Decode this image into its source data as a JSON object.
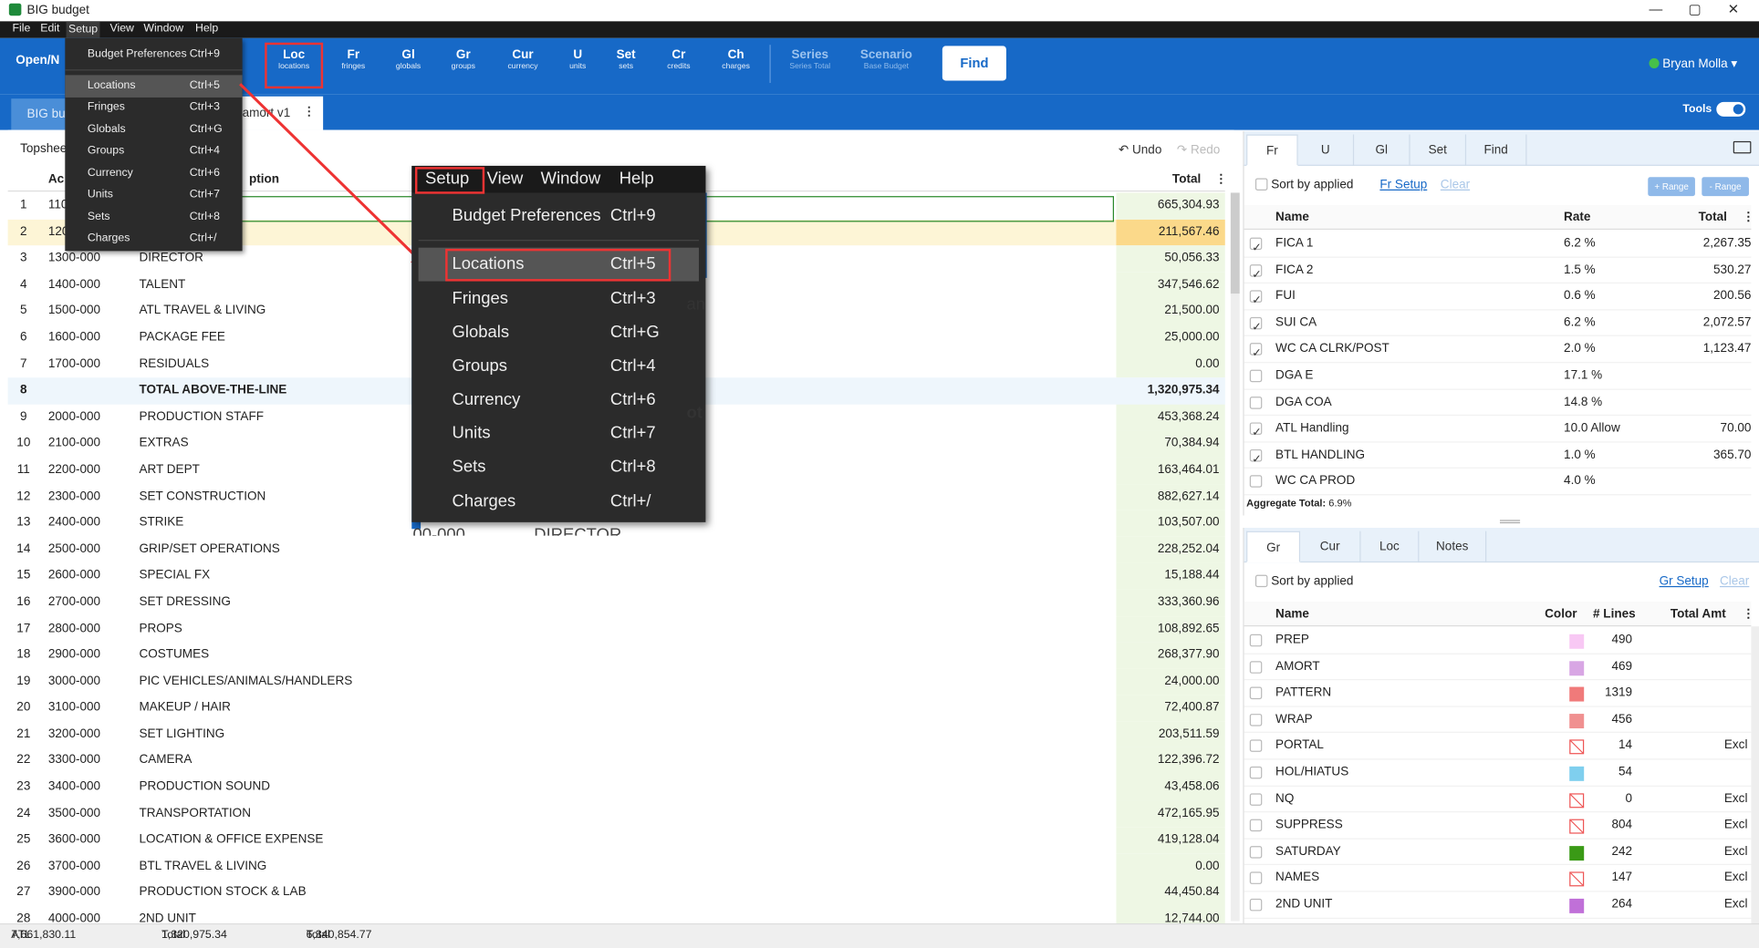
{
  "window": {
    "title": "BIG budget",
    "controls": [
      "—",
      "▢",
      "✕"
    ]
  },
  "menubar": [
    "File",
    "Edit",
    "Setup",
    "View",
    "Window",
    "Help"
  ],
  "toolbar": {
    "open_label": "Open/N",
    "buttons": [
      {
        "abbr": "Loc",
        "sub": "locations",
        "x": 239
      },
      {
        "abbr": "Fr",
        "sub": "fringes",
        "x": 292
      },
      {
        "abbr": "Gl",
        "sub": "globals",
        "x": 341
      },
      {
        "abbr": "Gr",
        "sub": "groups",
        "x": 390
      },
      {
        "abbr": "Cur",
        "sub": "currency",
        "x": 443
      },
      {
        "abbr": "U",
        "sub": "units",
        "x": 492
      },
      {
        "abbr": "Set",
        "sub": "sets",
        "x": 535
      },
      {
        "abbr": "Cr",
        "sub": "credits",
        "x": 582
      },
      {
        "abbr": "Ch",
        "sub": "charges",
        "x": 633
      }
    ],
    "series": {
      "abbr": "Series",
      "sub": "Series Total"
    },
    "scenario": {
      "abbr": "Scenario",
      "sub": "Base Budget"
    },
    "find_label": "Find",
    "user_name": "Bryan Molla ▾"
  },
  "tabs": {
    "tab1": "BIG bu",
    "tab2": "amort v1",
    "tools_label": "Tools"
  },
  "topsheet": {
    "label": "Topshee",
    "undo": "↶ Undo",
    "redo": "↷ Redo",
    "col_account": "Ac",
    "col_description": "ption",
    "col_total": "Total",
    "rows": [
      {
        "n": "1",
        "acct": "110",
        "desc": "",
        "total": "665,304.93"
      },
      {
        "n": "2",
        "acct": "120",
        "desc": "",
        "total": "211,567.46"
      },
      {
        "n": "3",
        "acct": "1300-000",
        "desc": "DIRECTOR",
        "total": "50,056.33"
      },
      {
        "n": "4",
        "acct": "1400-000",
        "desc": "TALENT",
        "total": "347,546.62"
      },
      {
        "n": "5",
        "acct": "1500-000",
        "desc": "ATL TRAVEL & LIVING",
        "total": "21,500.00"
      },
      {
        "n": "6",
        "acct": "1600-000",
        "desc": "PACKAGE FEE",
        "total": "25,000.00"
      },
      {
        "n": "7",
        "acct": "1700-000",
        "desc": "RESIDUALS",
        "total": "0.00"
      },
      {
        "n": "8",
        "acct": "",
        "desc": "TOTAL ABOVE-THE-LINE",
        "total": "1,320,975.34"
      },
      {
        "n": "9",
        "acct": "2000-000",
        "desc": "PRODUCTION STAFF",
        "total": "453,368.24"
      },
      {
        "n": "10",
        "acct": "2100-000",
        "desc": "EXTRAS",
        "total": "70,384.94"
      },
      {
        "n": "11",
        "acct": "2200-000",
        "desc": "ART DEPT",
        "total": "163,464.01"
      },
      {
        "n": "12",
        "acct": "2300-000",
        "desc": "SET CONSTRUCTION",
        "total": "882,627.14"
      },
      {
        "n": "13",
        "acct": "2400-000",
        "desc": "STRIKE",
        "total": "103,507.00"
      },
      {
        "n": "14",
        "acct": "2500-000",
        "desc": "GRIP/SET OPERATIONS",
        "total": "228,252.04"
      },
      {
        "n": "15",
        "acct": "2600-000",
        "desc": "SPECIAL FX",
        "total": "15,188.44"
      },
      {
        "n": "16",
        "acct": "2700-000",
        "desc": "SET DRESSING",
        "total": "333,360.96"
      },
      {
        "n": "17",
        "acct": "2800-000",
        "desc": "PROPS",
        "total": "108,892.65"
      },
      {
        "n": "18",
        "acct": "2900-000",
        "desc": "COSTUMES",
        "total": "268,377.90"
      },
      {
        "n": "19",
        "acct": "3000-000",
        "desc": "PIC VEHICLES/ANIMALS/HANDLERS",
        "total": "24,000.00"
      },
      {
        "n": "20",
        "acct": "3100-000",
        "desc": "MAKEUP / HAIR",
        "total": "72,400.87"
      },
      {
        "n": "21",
        "acct": "3200-000",
        "desc": "SET LIGHTING",
        "total": "203,511.59"
      },
      {
        "n": "22",
        "acct": "3300-000",
        "desc": "CAMERA",
        "total": "122,396.72"
      },
      {
        "n": "23",
        "acct": "3400-000",
        "desc": "PRODUCTION SOUND",
        "total": "43,458.06"
      },
      {
        "n": "24",
        "acct": "3500-000",
        "desc": "TRANSPORTATION",
        "total": "472,165.95"
      },
      {
        "n": "25",
        "acct": "3600-000",
        "desc": "LOCATION & OFFICE EXPENSE",
        "total": "419,128.04"
      },
      {
        "n": "26",
        "acct": "3700-000",
        "desc": "BTL TRAVEL & LIVING",
        "total": "0.00"
      },
      {
        "n": "27",
        "acct": "3900-000",
        "desc": "PRODUCTION STOCK & LAB",
        "total": "44,450.84"
      },
      {
        "n": "28",
        "acct": "4000-000",
        "desc": "2ND UNIT",
        "total": "12,744.00"
      }
    ]
  },
  "fringes_panel": {
    "tabs": [
      "Fr",
      "U",
      "Gl",
      "Set",
      "Find"
    ],
    "sort_label": "Sort by applied",
    "setup_link": "Fr Setup",
    "clear_link": "Clear",
    "add_range": "+ Range",
    "remove_range": "- Range",
    "col_name": "Name",
    "col_rate": "Rate",
    "col_total": "Total",
    "rows": [
      {
        "checked": true,
        "name": "FICA 1",
        "rate": "6.2 %",
        "total": "2,267.35"
      },
      {
        "checked": true,
        "name": "FICA 2",
        "rate": "1.5 %",
        "total": "530.27"
      },
      {
        "checked": true,
        "name": "FUI",
        "rate": "0.6 %",
        "total": "200.56"
      },
      {
        "checked": true,
        "name": "SUI CA",
        "rate": "6.2 %",
        "total": "2,072.57"
      },
      {
        "checked": true,
        "name": "WC CA CLRK/POST",
        "rate": "2.0 %",
        "total": "1,123.47"
      },
      {
        "checked": false,
        "name": "DGA E",
        "rate": "17.1 %",
        "total": ""
      },
      {
        "checked": false,
        "name": "DGA COA",
        "rate": "14.8 %",
        "total": ""
      },
      {
        "checked": true,
        "name": "ATL Handling",
        "rate": "10.0 Allow",
        "total": "70.00"
      },
      {
        "checked": true,
        "name": "BTL HANDLING",
        "rate": "1.0 %",
        "total": "365.70"
      },
      {
        "checked": false,
        "name": "WC CA PROD",
        "rate": "4.0 %",
        "total": ""
      }
    ],
    "aggregate_label": "Aggregate Total:",
    "aggregate_value": "6.9%"
  },
  "groups_panel": {
    "tabs": [
      "Gr",
      "Cur",
      "Loc",
      "Notes"
    ],
    "sort_label": "Sort by applied",
    "setup_link": "Gr Setup",
    "clear_link": "Clear",
    "col_name": "Name",
    "col_color": "Color",
    "col_lines": "# Lines",
    "col_total": "Total Amt",
    "rows": [
      {
        "name": "PREP",
        "color": "#f8c8f4",
        "lines": "490",
        "excl": ""
      },
      {
        "name": "AMORT",
        "color": "#d8a6e4",
        "lines": "469",
        "excl": ""
      },
      {
        "name": "PATTERN",
        "color": "#f07a7a",
        "lines": "1319",
        "excl": ""
      },
      {
        "name": "WRAP",
        "color": "#f09090",
        "lines": "456",
        "excl": ""
      },
      {
        "name": "PORTAL",
        "color": "none",
        "lines": "14",
        "excl": "Excl"
      },
      {
        "name": "HOL/HIATUS",
        "color": "#7fcfee",
        "lines": "54",
        "excl": ""
      },
      {
        "name": "NQ",
        "color": "none",
        "lines": "0",
        "excl": "Excl"
      },
      {
        "name": "SUPPRESS",
        "color": "none",
        "lines": "804",
        "excl": "Excl"
      },
      {
        "name": "SATURDAY",
        "color": "#3a9a16",
        "lines": "242",
        "excl": "Excl"
      },
      {
        "name": "NAMES",
        "color": "none",
        "lines": "147",
        "excl": "Excl"
      },
      {
        "name": "2ND UNIT",
        "color": "#c070d8",
        "lines": "264",
        "excl": "Excl"
      }
    ]
  },
  "status": {
    "atl_btl_label": "ATL & BTL:",
    "atl_btl": "7,661,830.11",
    "atl_label": "Total ATL:",
    "atl": "1,320,975.34",
    "btl_label": "Total BTL:",
    "btl": "6,340,854.77"
  },
  "setup_menu": {
    "items": [
      {
        "label": "Budget Preferences",
        "key": "Ctrl+9"
      },
      {
        "label": "Locations",
        "key": "Ctrl+5"
      },
      {
        "label": "Fringes",
        "key": "Ctrl+3"
      },
      {
        "label": "Globals",
        "key": "Ctrl+G"
      },
      {
        "label": "Groups",
        "key": "Ctrl+4"
      },
      {
        "label": "Currency",
        "key": "Ctrl+6"
      },
      {
        "label": "Units",
        "key": "Ctrl+7"
      },
      {
        "label": "Sets",
        "key": "Ctrl+8"
      },
      {
        "label": "Charges",
        "key": "Ctrl+/"
      }
    ]
  },
  "zoom_callout": {
    "menubar": [
      "Setup",
      "View",
      "Window",
      "Help"
    ],
    "frag1": "an",
    "frag2": "ot",
    "frag3": "00-000",
    "frag4": "DIRECTOR"
  },
  "colors": {
    "accent": "#1769c7",
    "highlight": "#e33333"
  }
}
